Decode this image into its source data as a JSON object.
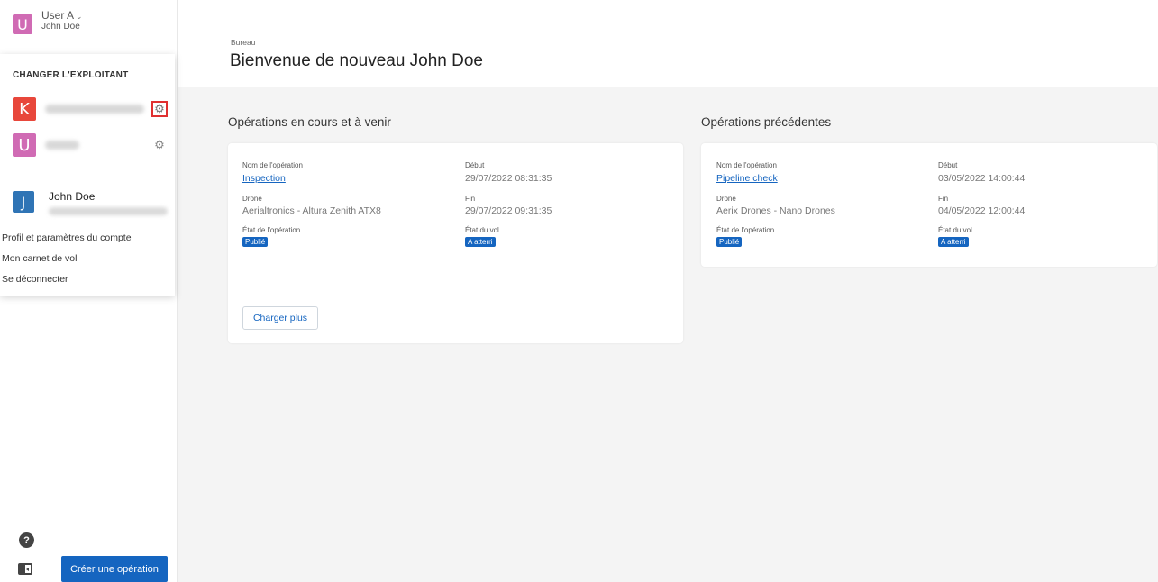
{
  "user": {
    "initial": "U",
    "name": "User A",
    "fullname": "John Doe"
  },
  "dropdown": {
    "title": "CHANGER L'EXPLOITANT",
    "operators": [
      {
        "initial": "K",
        "color": "#e8473b"
      },
      {
        "initial": "U",
        "color": "#d06bb4"
      }
    ],
    "me": {
      "initial": "J",
      "name": "John Doe"
    },
    "links": [
      "Profil et paramètres du compte",
      "Mon carnet de vol",
      "Se déconnecter"
    ]
  },
  "footer": {
    "create_label": "Créer une opération",
    "help_glyph": "?"
  },
  "header": {
    "breadcrumb": "Bureau",
    "title": "Bienvenue de nouveau John Doe"
  },
  "current": {
    "title": "Opérations en cours et à venir",
    "operation": {
      "name_label": "Nom de l'opération",
      "name": "Inspection",
      "start_label": "Début",
      "start": "29/07/2022 08:31:35",
      "drone_label": "Drone",
      "drone": "Aerialtronics - Altura Zenith ATX8",
      "end_label": "Fin",
      "end": "29/07/2022 09:31:35",
      "op_state_label": "État de l'opération",
      "op_state": "Publié",
      "flight_state_label": "État du vol",
      "flight_state": "A atterri"
    },
    "load_more": "Charger plus"
  },
  "previous": {
    "title": "Opérations précédentes",
    "operation": {
      "name_label": "Nom de l'opération",
      "name": "Pipeline check",
      "start_label": "Début",
      "start": "03/05/2022 14:00:44",
      "drone_label": "Drone",
      "drone": "Aerix Drones - Nano Drones",
      "end_label": "Fin",
      "end": "04/05/2022 12:00:44",
      "op_state_label": "État de l'opération",
      "op_state": "Publié",
      "flight_state_label": "État du vol",
      "flight_state": "A atterri"
    }
  },
  "colors": {
    "primary": "#1565c0",
    "highlight": "#e03131"
  }
}
